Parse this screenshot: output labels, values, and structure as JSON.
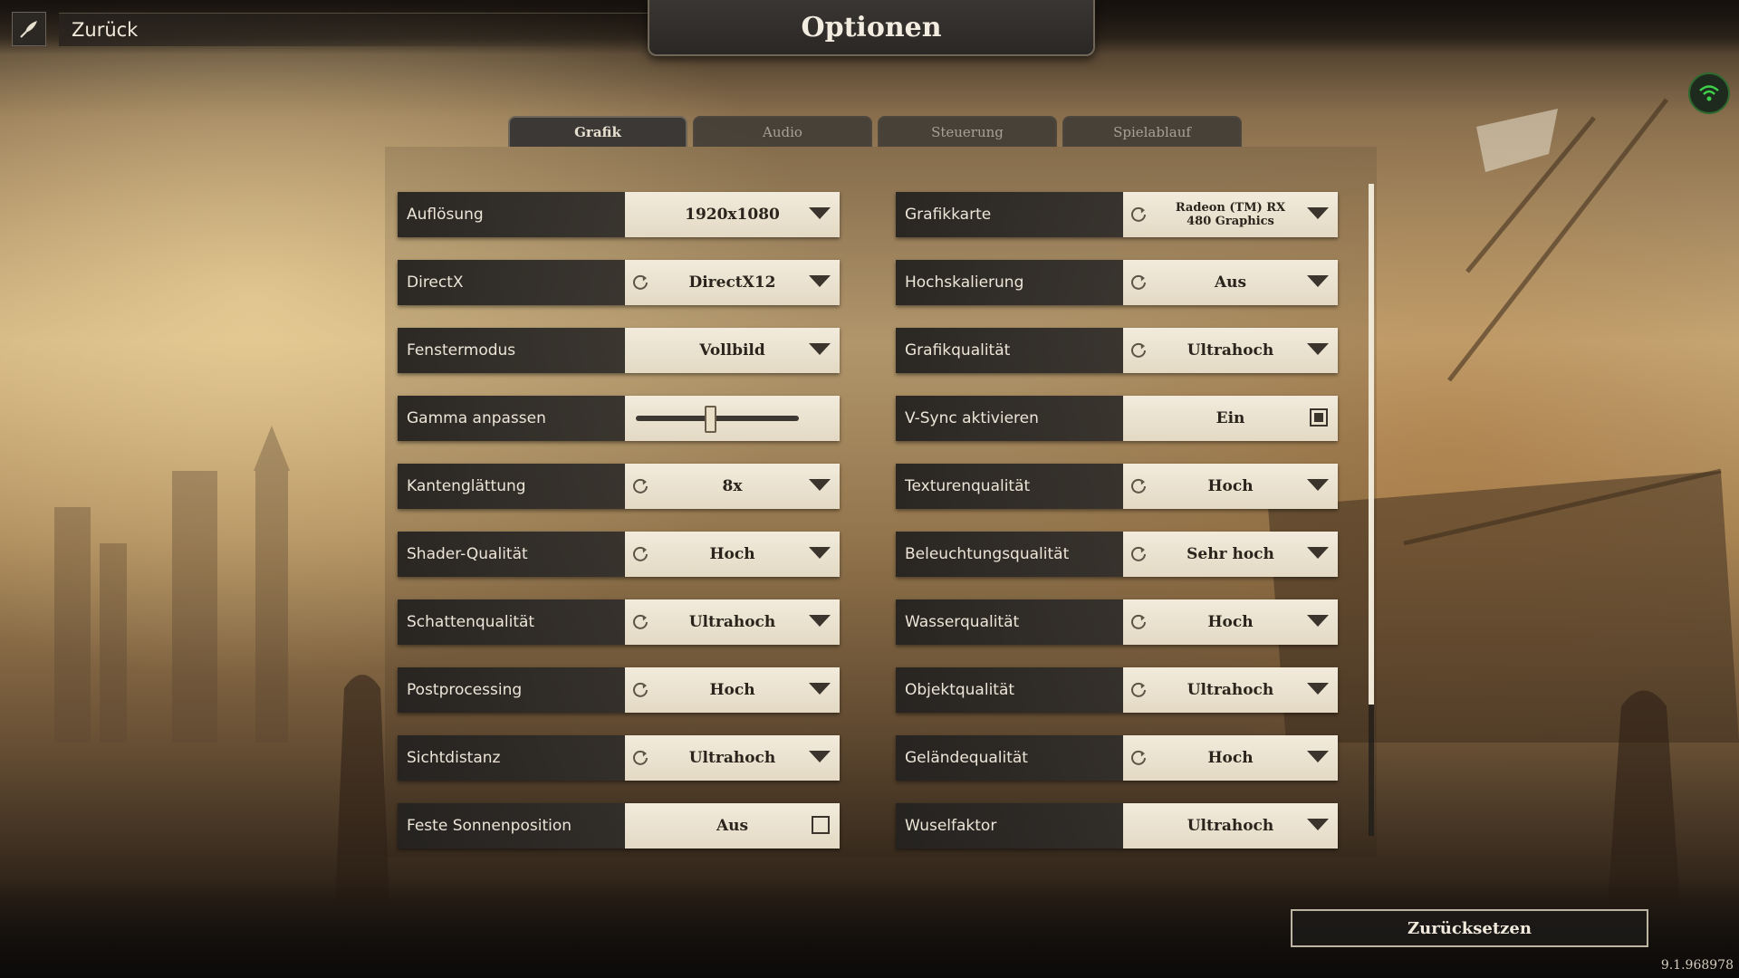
{
  "header": {
    "back_label": "Zurück",
    "title": "Optionen"
  },
  "tabs": [
    {
      "label": "Grafik",
      "active": true
    },
    {
      "label": "Audio",
      "active": false
    },
    {
      "label": "Steuerung",
      "active": false
    },
    {
      "label": "Spielablauf",
      "active": false
    }
  ],
  "left": [
    {
      "label": "Auflösung",
      "value": "1920x1080",
      "control": "dropdown",
      "reset": false
    },
    {
      "label": "DirectX",
      "value": "DirectX12",
      "control": "dropdown",
      "reset": true
    },
    {
      "label": "Fenstermodus",
      "value": "Vollbild",
      "control": "dropdown",
      "reset": false
    },
    {
      "label": "Gamma anpassen",
      "value": null,
      "control": "slider",
      "slider_fraction": 0.45
    },
    {
      "label": "Kantenglättung",
      "value": "8x",
      "control": "dropdown",
      "reset": true
    },
    {
      "label": "Shader-Qualität",
      "value": "Hoch",
      "control": "dropdown",
      "reset": true
    },
    {
      "label": "Schattenqualität",
      "value": "Ultrahoch",
      "control": "dropdown",
      "reset": true
    },
    {
      "label": "Postprocessing",
      "value": "Hoch",
      "control": "dropdown",
      "reset": true
    },
    {
      "label": "Sichtdistanz",
      "value": "Ultrahoch",
      "control": "dropdown",
      "reset": true
    },
    {
      "label": "Feste Sonnenposition",
      "value": "Aus",
      "control": "checkbox",
      "checked": false
    }
  ],
  "right": [
    {
      "label": "Grafikkarte",
      "value": "Radeon (TM) RX 480 Graphics",
      "control": "dropdown",
      "reset": true,
      "small": true
    },
    {
      "label": "Hochskalierung",
      "value": "Aus",
      "control": "dropdown",
      "reset": true
    },
    {
      "label": "Grafikqualität",
      "value": "Ultrahoch",
      "control": "dropdown",
      "reset": true
    },
    {
      "label": "V-Sync aktivieren",
      "value": "Ein",
      "control": "checkbox",
      "checked": true
    },
    {
      "label": "Texturenqualität",
      "value": "Hoch",
      "control": "dropdown",
      "reset": true
    },
    {
      "label": "Beleuchtungsqualität",
      "value": "Sehr hoch",
      "control": "dropdown",
      "reset": true
    },
    {
      "label": "Wasserqualität",
      "value": "Hoch",
      "control": "dropdown",
      "reset": true
    },
    {
      "label": "Objektqualität",
      "value": "Ultrahoch",
      "control": "dropdown",
      "reset": true
    },
    {
      "label": "Geländequalität",
      "value": "Hoch",
      "control": "dropdown",
      "reset": true
    },
    {
      "label": "Wuselfaktor",
      "value": "Ultrahoch",
      "control": "dropdown",
      "reset": false
    }
  ],
  "footer": {
    "reset_label": "Zurücksetzen",
    "version": "9.1.968978"
  },
  "icons": {
    "back": "quill-back-icon",
    "network": "wifi-icon",
    "reset": "reset-icon",
    "dropdown": "chevron-down-icon"
  }
}
